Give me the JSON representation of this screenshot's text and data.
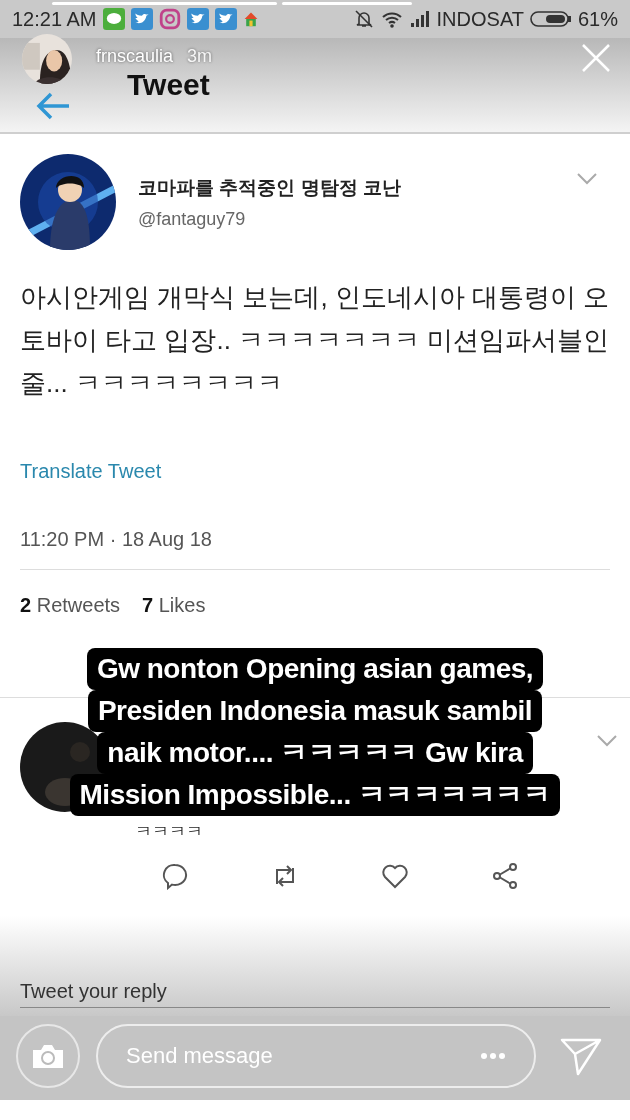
{
  "status_bar": {
    "time": "12:21 AM",
    "apps": [
      {
        "kind": "chat"
      },
      {
        "kind": "bird"
      },
      {
        "kind": "camera"
      },
      {
        "kind": "bird"
      },
      {
        "kind": "bird"
      },
      {
        "kind": "house"
      }
    ],
    "carrier": "INDOSAT",
    "battery": "61%"
  },
  "story": {
    "username": "frnscaulia",
    "age": "3m",
    "caption_lines": [
      "Gw nonton Opening asian games,",
      "Presiden Indonesia masuk sambil",
      "naik motor.... ㅋㅋㅋㅋㅋ Gw kira",
      "Mission Impossible... ㅋㅋㅋㅋㅋㅋㅋ"
    ],
    "message_placeholder": "Send message"
  },
  "app_bar": {
    "title": "Tweet"
  },
  "tweet": {
    "name": "코마파를 추적중인 명탐정 코난",
    "handle": "@fantaguy79",
    "text": "아시안게임 개막식 보는데, 인도네시아 대통령이 오토바이 타고 입장.. ㅋㅋㅋㅋㅋㅋㅋ 미션임파서블인줄... ㅋㅋㅋㅋㅋㅋㅋㅋ",
    "translate": "Translate Tweet",
    "timestamp": "11:20 PM · 18 Aug 18",
    "stats": [
      {
        "count": "2",
        "label": "Retweets"
      },
      {
        "count": "7",
        "label": "Likes"
      }
    ]
  },
  "reply": {
    "text": "ㅋㅋㅋㅋ"
  },
  "reply_field": {
    "placeholder": "Tweet your reply"
  }
}
